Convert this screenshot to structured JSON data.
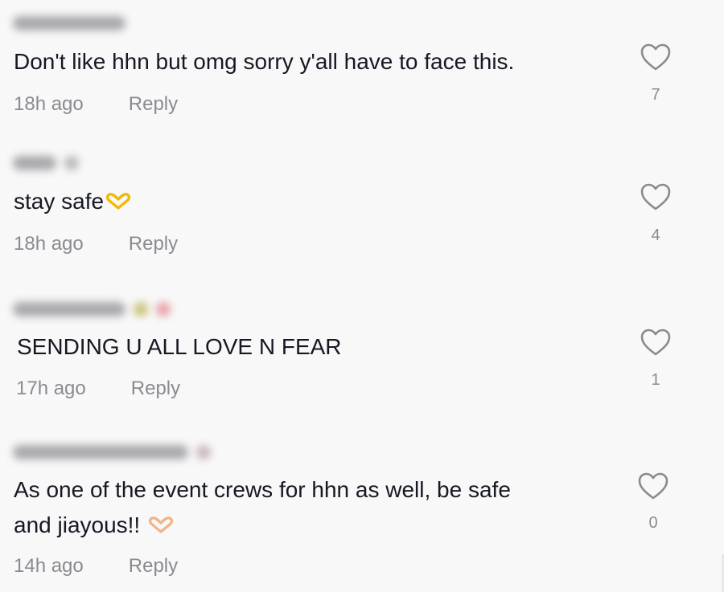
{
  "comments": [
    {
      "text": "Don't like hhn but omg sorry y'all have to face this.",
      "time": "18h ago",
      "reply_label": "Reply",
      "likes": "7",
      "icon": "heart-outline-icon"
    },
    {
      "text": "stay safe",
      "emoji": "heart-hands-emoji",
      "time": "18h ago",
      "reply_label": "Reply",
      "likes": "4",
      "icon": "heart-outline-icon"
    },
    {
      "text": "SENDING U ALL LOVE N FEAR",
      "time": "17h ago",
      "reply_label": "Reply",
      "likes": "1",
      "icon": "heart-outline-icon"
    },
    {
      "text_line1": "As one of the event crews for hhn as well, be safe",
      "text_line2": "and jiayous!! ",
      "emoji": "heart-hands-emoji",
      "time": "14h ago",
      "reply_label": "Reply",
      "likes": "0",
      "icon": "heart-outline-icon"
    }
  ],
  "colors": {
    "background": "#f8f8f8",
    "text": "#161823",
    "secondary": "#8a8b91",
    "emoji_gold": "#f5b800",
    "emoji_skin": "#f2b48a"
  }
}
